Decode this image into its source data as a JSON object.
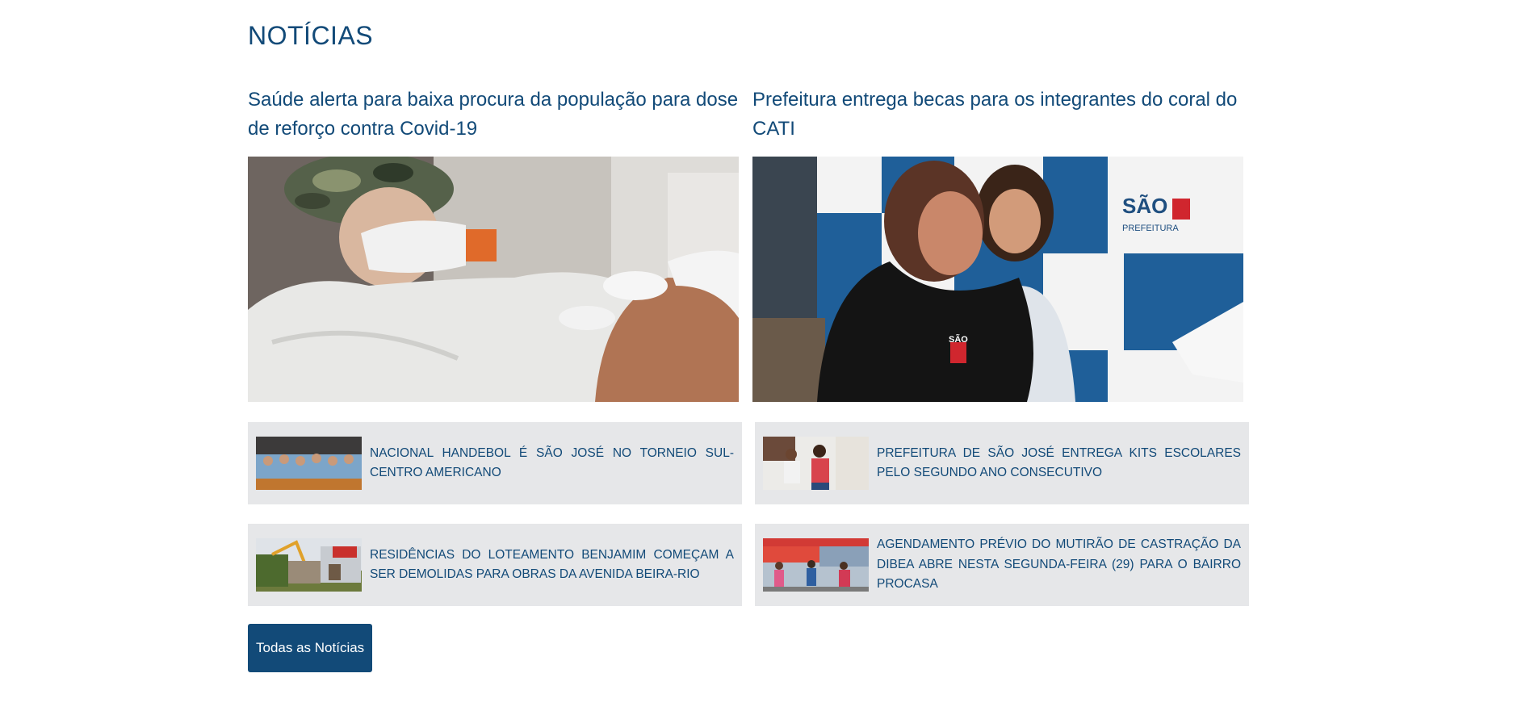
{
  "section": {
    "title": "NOTÍCIAS"
  },
  "featured": [
    {
      "title": "Saúde alerta para baixa procura da população para dose de reforço contra Covid-19",
      "image": "vaccination-photo"
    },
    {
      "title": "Prefeitura entrega becas para os integrantes do coral do CATI",
      "image": "choir-gown-photo",
      "image_text": "SÃO JOSÉ PREFEITURA"
    }
  ],
  "news": [
    {
      "headline": "NACIONAL HANDEBOL É SÃO JOSÉ NO TORNEIO SUL-CENTRO AMERICANO",
      "image": "handball-team-photo"
    },
    {
      "headline": "PREFEITURA DE SÃO JOSÉ ENTREGA KITS ESCOLARES PELO SEGUNDO ANO CONSECUTIVO",
      "image": "school-kits-photo"
    },
    {
      "headline": "RESIDÊNCIAS DO LOTEAMENTO BENJAMIM COMEÇAM A SER DEMOLIDAS PARA OBRAS DA AVENIDA BEIRA-RIO",
      "image": "demolition-photo"
    },
    {
      "headline": "AGENDAMENTO PRÉVIO DO MUTIRÃO DE CASTRAÇÃO DA DIBEA ABRE NESTA SEGUNDA-FEIRA (29) PARA O BAIRRO PROCASA",
      "image": "castration-event-photo"
    }
  ],
  "button": {
    "label": "Todas as Notícias"
  },
  "colors": {
    "primary": "#124a78",
    "card_background": "#e6e7e9"
  }
}
